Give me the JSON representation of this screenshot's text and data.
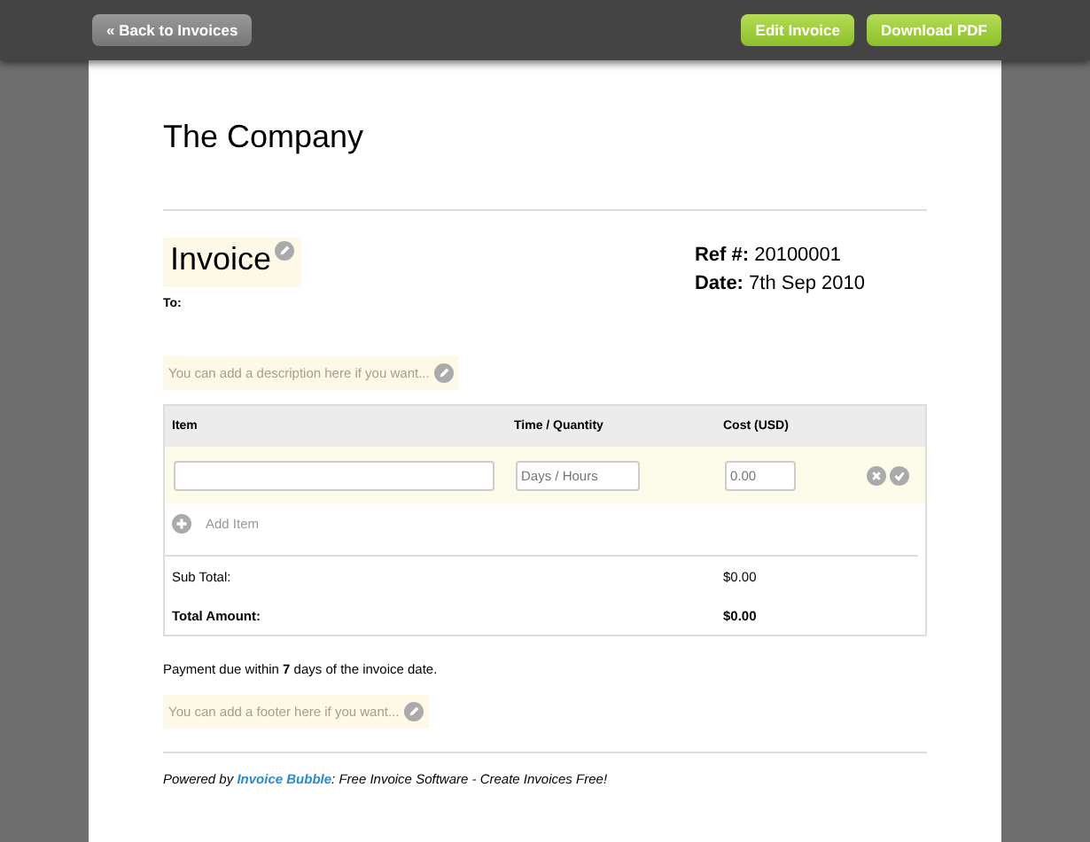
{
  "toolbar": {
    "back": "« Back to Invoices",
    "actions": [
      "Edit Invoice",
      "Download PDF"
    ]
  },
  "company": "The Company",
  "invoice": {
    "title": "Invoice",
    "ref": "**Ref #:** 20100001",
    "date": "**Date:** 7th Sep 2010",
    "to": "To:",
    "description_placeholder": "You can add a description here if you want..."
  },
  "table": {
    "columns": [
      "Item",
      "Time / Quantity",
      "Cost (USD)"
    ],
    "row": {
      "quantity_placeholder": "Days / Hours",
      "cost_placeholder": "0.00"
    },
    "add_item": "Add Item",
    "totals": [
      {
        "label": "Sub Total:",
        "value": "$0.00",
        "bold": false
      },
      {
        "label": "Total Amount:",
        "value": "$0.00",
        "bold": true
      }
    ]
  },
  "payment_terms": "Payment due within **7** days of the invoice date.",
  "footer_placeholder": "You can add a footer here if you want...",
  "credit": {
    "prefix": "Powered by ",
    "link": "Invoice Bubble",
    "suffix": ": Free Invoice Software - Create Invoices Free!"
  }
}
